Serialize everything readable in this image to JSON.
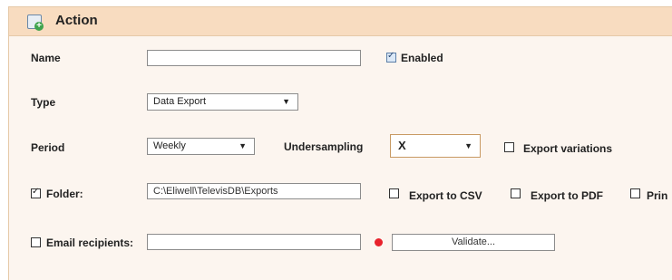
{
  "header": {
    "title": "Action",
    "icon": "add-action-icon"
  },
  "name": {
    "label": "Name",
    "value": "",
    "enabled_label": "Enabled",
    "enabled": true
  },
  "type": {
    "label": "Type",
    "selected": "Data Export"
  },
  "period": {
    "label": "Period",
    "selected": "Weekly",
    "undersampling_label": "Undersampling",
    "undersampling_selected": "X",
    "export_variations_label": "Export variations",
    "export_variations": false
  },
  "folder": {
    "label": "Folder:",
    "checked": true,
    "value": "C:\\Eliwell\\TelevisDB\\Exports",
    "csv_label": "Export to CSV",
    "pdf_label": "Export to PDF",
    "print_label": "Prin"
  },
  "email": {
    "label": "Email recipients:",
    "checked": false,
    "value": "",
    "status_color": "#e8222c",
    "validate_label": "Validate..."
  }
}
